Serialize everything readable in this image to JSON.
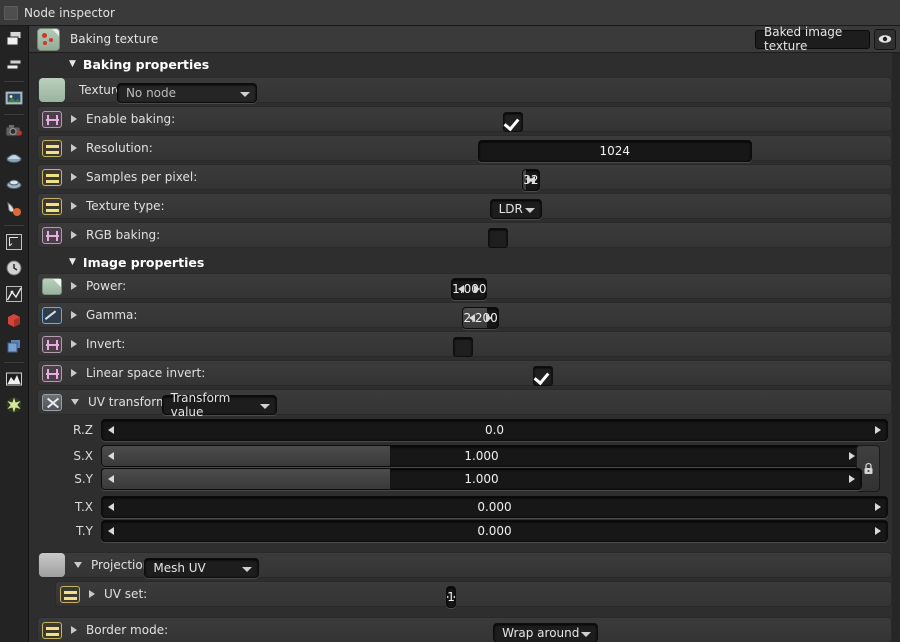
{
  "window": {
    "title": "Node inspector"
  },
  "toolbar": {
    "items": [
      {
        "name": "layers-icon"
      },
      {
        "name": "stack-icon"
      },
      {
        "name": "image-icon"
      },
      {
        "name": "camera-icon"
      },
      {
        "name": "environment-icon"
      },
      {
        "name": "material-icon"
      },
      {
        "name": "paint-icon"
      },
      {
        "name": "frame-icon"
      },
      {
        "name": "clock-icon"
      },
      {
        "name": "texture-icon"
      },
      {
        "name": "red-cube-icon"
      },
      {
        "name": "blue-cubes-icon"
      },
      {
        "name": "histogram-icon"
      },
      {
        "name": "light-icon"
      }
    ]
  },
  "node_header": {
    "icon": "baking-texture-icon",
    "title": "Baking texture",
    "type_dropdown": "Baked image texture",
    "preview_icon": "eye-icon"
  },
  "sections": {
    "baking": {
      "title": "Baking properties",
      "caret": "▼",
      "texture": {
        "label": "Texture",
        "node_value": "No node"
      },
      "enable_baking": {
        "label": "Enable baking:",
        "checked": true
      },
      "resolution": {
        "label": "Resolution:",
        "width": "1024",
        "height": "1024"
      },
      "samples": {
        "label": "Samples per pixel:",
        "value": "32",
        "fill_pct": 17
      },
      "texture_type": {
        "label": "Texture type:",
        "value": "LDR"
      },
      "rgb_baking": {
        "label": "RGB baking:",
        "checked": false
      }
    },
    "image": {
      "title": "Image properties",
      "caret": "▼",
      "power": {
        "label": "Power:",
        "value": "1.000",
        "fill_pct": 0
      },
      "gamma": {
        "label": "Gamma:",
        "value": "2.200",
        "fill_pct": 69
      },
      "invert": {
        "label": "Invert:",
        "checked": false
      },
      "linear_space_invert": {
        "label": "Linear space invert:",
        "checked": true
      }
    },
    "uv_transform": {
      "title": "UV transform",
      "caret": "▼",
      "mode_dropdown": "Transform value",
      "rows": [
        {
          "label": "R.Z",
          "value": "0.0",
          "fill_pct": 0,
          "locked": false
        },
        {
          "label": "S.X",
          "value": "1.000",
          "fill_pct": 38,
          "locked": true
        },
        {
          "label": "S.Y",
          "value": "1.000",
          "fill_pct": 38,
          "locked": true
        },
        {
          "label": "T.X",
          "value": "0.000",
          "fill_pct": 0,
          "locked": false
        },
        {
          "label": "T.Y",
          "value": "0.000",
          "fill_pct": 0,
          "locked": false
        }
      ],
      "lock_icon": "lock-icon"
    },
    "projection": {
      "title": "Projection",
      "caret": "▼",
      "mode_dropdown": "Mesh UV",
      "uv_set": {
        "label": "UV set:",
        "value": "1",
        "fill_pct": 0
      }
    },
    "border_mode": {
      "label": "Border mode:",
      "value": "Wrap around"
    }
  }
}
